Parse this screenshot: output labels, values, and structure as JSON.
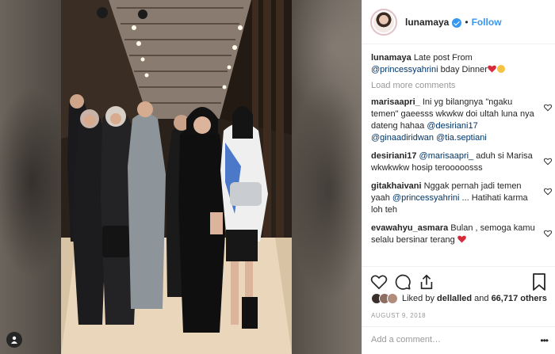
{
  "header": {
    "username": "lunamaya",
    "separator": "•",
    "follow_label": "Follow"
  },
  "caption": {
    "username": "lunamaya",
    "text_before": "Late post From",
    "mention": "@princessyahrini",
    "text_after": "bday Dinner"
  },
  "load_more_label": "Load more comments",
  "comments": [
    {
      "username": "marisaapri_",
      "text": "Ini yg bilangnya \"ngaku temen\" gaeesss wkwkw doi ultah luna nya dateng hahaa",
      "mentions": [
        "@desiriani17",
        "@ginaadiridwan",
        "@tia.septiani"
      ]
    },
    {
      "username": "desiriani17",
      "mention": "@marisaapri_",
      "text": "aduh si Marisa wkwkwkw hosip terooooosss"
    },
    {
      "username": "gitakhaivani",
      "text_before": "Nggak pernah jadi temen yaah",
      "mention": "@princessyahrini",
      "text_after": "... Hatihati karma loh teh"
    },
    {
      "username": "evawahyu_asmara",
      "text": "Bulan , semoga kamu selalu bersinar terang"
    }
  ],
  "likes": {
    "prefix": "Liked by",
    "user": "dellalled",
    "conjunction": "and",
    "count": "66,717 others"
  },
  "date": "AUGUST 9, 2018",
  "add_comment_placeholder": "Add a comment…",
  "more_options": "•••",
  "colors": {
    "link": "#003569",
    "follow": "#3897f0",
    "heart": "#ed4956",
    "muted": "#999999"
  },
  "icons": [
    "heart-icon",
    "comment-icon",
    "share-icon",
    "bookmark-icon",
    "user-icon",
    "verified-icon"
  ]
}
